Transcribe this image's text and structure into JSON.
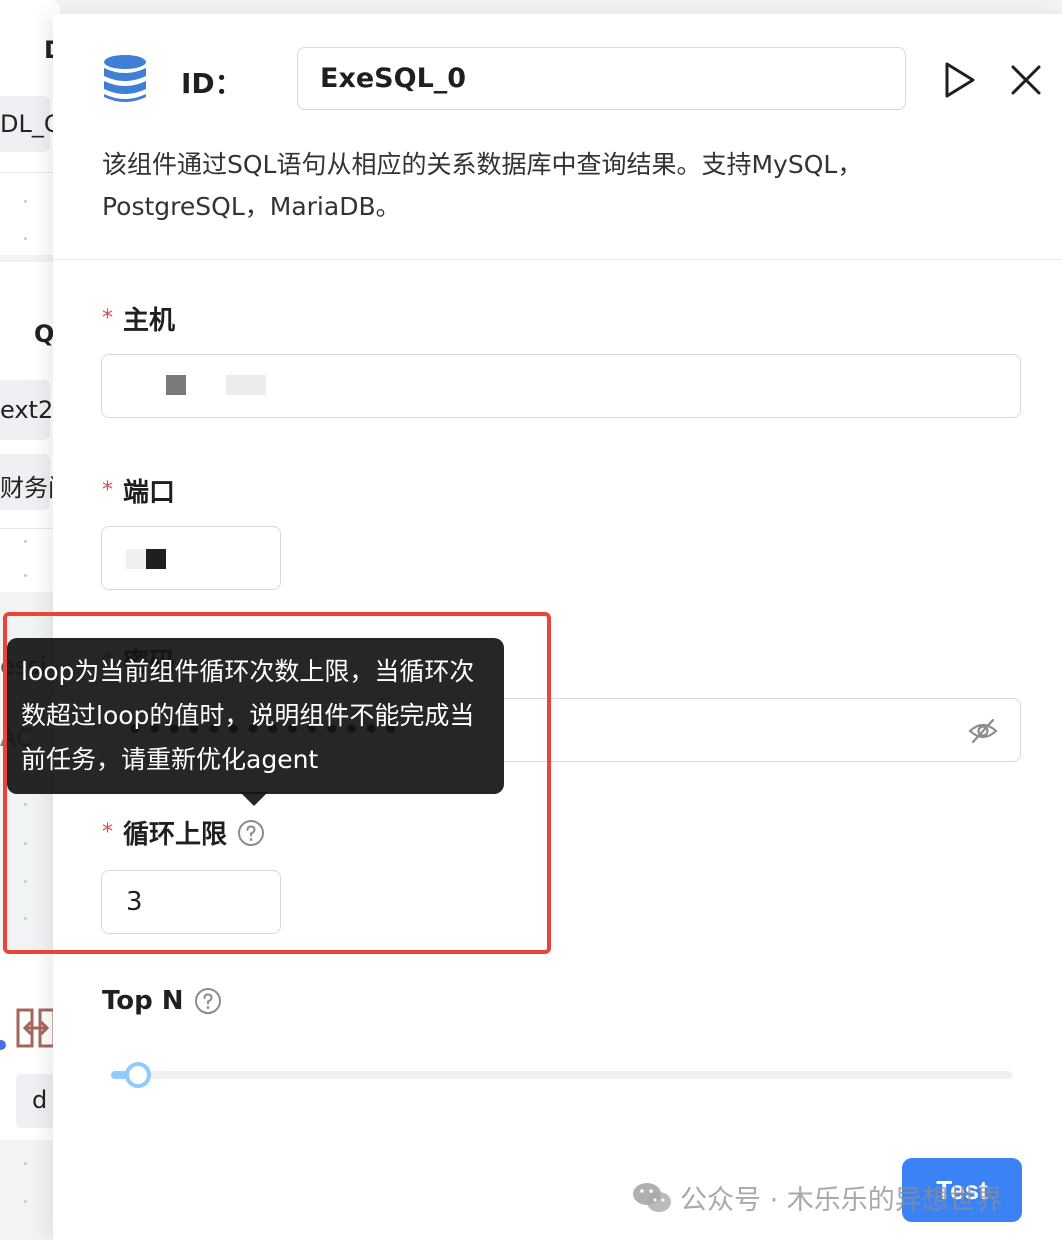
{
  "canvas": {
    "fragments": [
      "D",
      "DL_G",
      "Q",
      "ext2",
      "财务问",
      "essi",
      "AC",
      "d"
    ]
  },
  "node_panel": {
    "id_label": "ID：",
    "id_value": "ExeSQL_0",
    "description": "该组件通过SQL语句从相应的关系数据库中查询结果。支持MySQL，PostgreSQL，MariaDB。",
    "required_mark": "*",
    "fields": {
      "host": {
        "label": "主机"
      },
      "port": {
        "label": "端口"
      },
      "password": {
        "label": "密码",
        "value": "••••••••••••••"
      },
      "loop": {
        "label": "循环上限",
        "value": "3"
      },
      "top_n": {
        "label": "Top N",
        "value": 0.03
      }
    },
    "test_button": "Test"
  },
  "tooltip": {
    "text": "loop为当前组件循环次数上限，当循环次数超过loop的值时，说明组件不能完成当前任务，请重新优化agent"
  },
  "watermark": {
    "text": "公众号 · 木乐乐的异想世界"
  },
  "colors": {
    "accent": "#3b82f6",
    "required": "#e5484d",
    "highlight": "#e8443a",
    "slider": "#91caff",
    "db_icon": "#3f7fd6"
  },
  "icons": {
    "db": "database-icon",
    "run": "play-icon",
    "close": "close-icon",
    "help": "question-circle-icon",
    "visibility": "eye-off-icon",
    "wechat": "wechat-icon"
  }
}
